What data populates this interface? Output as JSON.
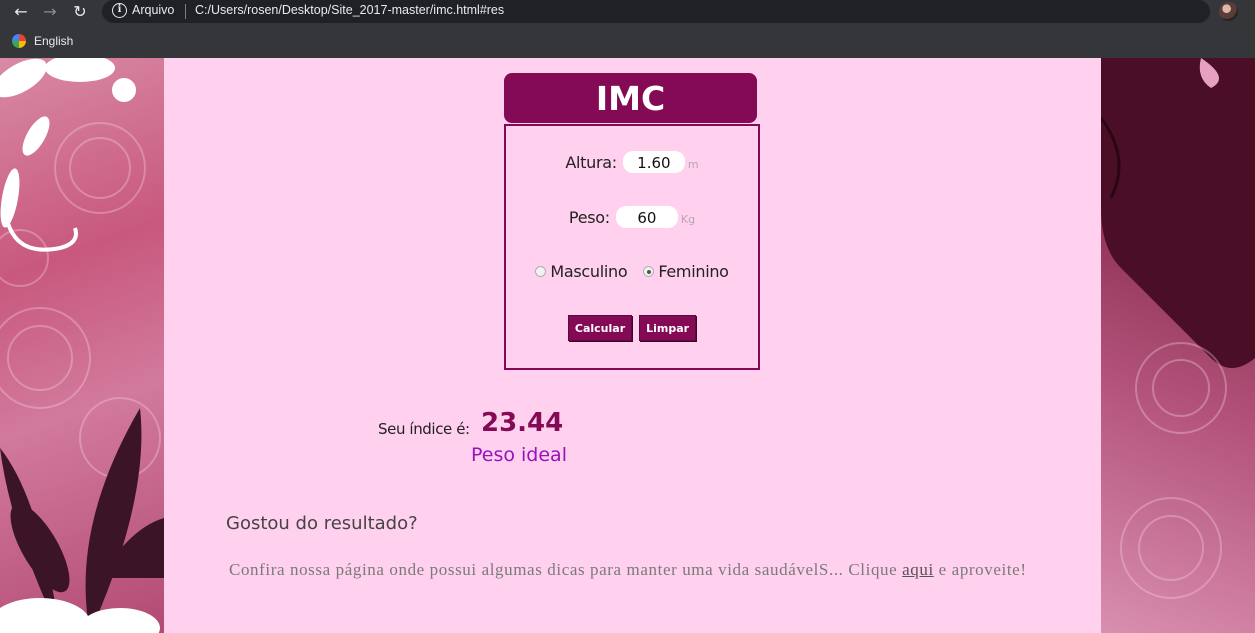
{
  "browser": {
    "scheme_label": "Arquivo",
    "url": "C:/Users/rosen/Desktop/Site_2017-master/imc.html#res",
    "bookmark": "English",
    "icons": [
      "back-icon",
      "forward-icon",
      "reload-icon",
      "info-icon",
      "star-icon"
    ]
  },
  "form": {
    "title": "IMC",
    "altura_label": "Altura:",
    "altura_value": "1.60",
    "altura_unit": "m",
    "peso_label": "Peso:",
    "peso_value": "60",
    "peso_unit": "Kg",
    "sex_options": [
      {
        "label": "Masculino",
        "checked": false
      },
      {
        "label": "Feminino",
        "checked": true
      }
    ],
    "calc_button": "Calcular",
    "clear_button": "Limpar"
  },
  "result": {
    "label": "Seu índice é:",
    "value": "23.44",
    "status": "Peso ideal"
  },
  "cta": {
    "title": "Gostou do resultado?",
    "text_before": "Confira nossa página onde possui algumas dicas para manter uma vida saudávelS... Clique ",
    "link": "aqui",
    "text_after": " e aproveite!"
  },
  "colors": {
    "accent": "#850a56",
    "page_bg": "#ffd1ee",
    "status": "#9911bb"
  }
}
